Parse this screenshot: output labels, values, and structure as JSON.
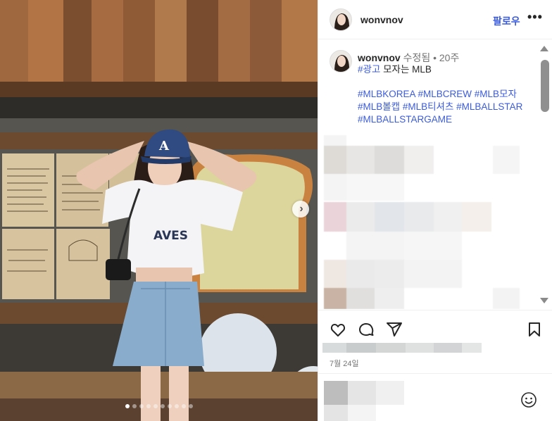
{
  "post": {
    "username": "wonvnov",
    "follow_label": "팔로우",
    "more_label": "•••",
    "slide_count": 10,
    "active_slide": 0
  },
  "caption": {
    "username": "wonvnov",
    "edited_label": "수정됨",
    "separator": "•",
    "time_ago": "20주",
    "ad_tag": "#광고",
    "text": " 모자는 MLB",
    "hashtags_line1": "#MLBKOREA #MLBCREW #MLB모자",
    "hashtags_line2": "#MLB볼캡 #MLB티셔츠 #MLBALLSTAR",
    "hashtags_line3": "#MLBALLSTARGAME"
  },
  "date_label": "7월 24일",
  "colors": {
    "link": "#3b5bdb",
    "muted": "#737373",
    "text": "#262626"
  },
  "icons": [
    "like-heart-icon",
    "comment-icon",
    "share-icon",
    "save-bookmark-icon",
    "emoji-icon",
    "chevron-right-icon",
    "more-options-icon"
  ]
}
